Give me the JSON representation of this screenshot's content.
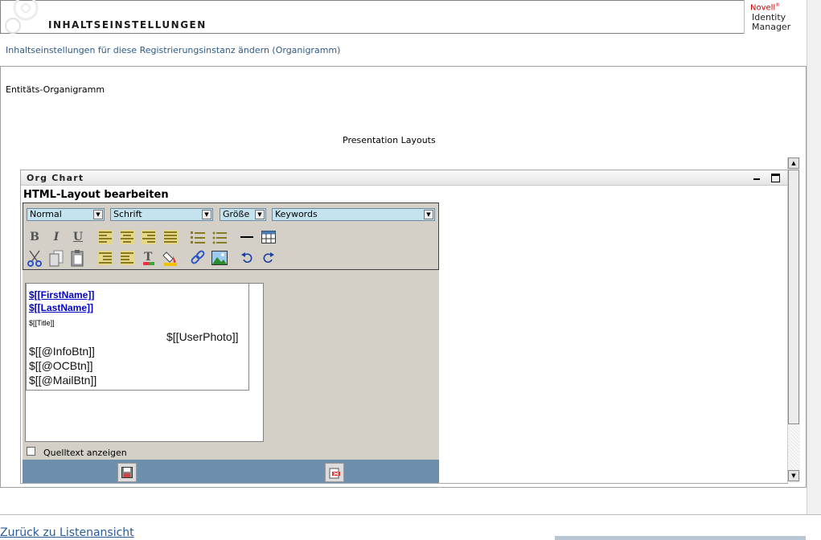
{
  "header": {
    "title": "INHALTSEINSTELLUNGEN",
    "brand_novell": "Novell",
    "brand_line1": "Identity",
    "brand_line2": "Manager"
  },
  "subtitle": "Inhaltseinstellungen für diese Registrierungsinstanz ändern (Organigramm)",
  "entity_label": "Entitäts-Organigramm",
  "layouts_label": "Presentation Layouts",
  "portlet": {
    "title": "Org Chart",
    "minimize_icon": "minimize-icon",
    "maximize_icon": "maximize-icon"
  },
  "editor": {
    "heading": "HTML-Layout bearbeiten",
    "selects": {
      "format": "Normal",
      "font": "Schrift",
      "size": "Größe",
      "keywords": "Keywords"
    },
    "content": {
      "first_name": "$[[FirstName]]",
      "last_name": "$[[LastName]]",
      "title": "$[[Title]]",
      "user_photo": "$[[UserPhoto]]",
      "info_btn": "$[[@InfoBtn]]",
      "oc_btn": "$[[@OCBtn]]",
      "mail_btn": "$[[@MailBtn]]"
    },
    "source_label": "Quelltext anzeigen"
  },
  "back_link": "Zurück zu Listenansicht",
  "colors": {
    "accent": "#2e5b86",
    "footer_bar": "#6d8fab",
    "select_bg": "#c5e3ee",
    "toolbar_bg": "#d4d0c8"
  }
}
